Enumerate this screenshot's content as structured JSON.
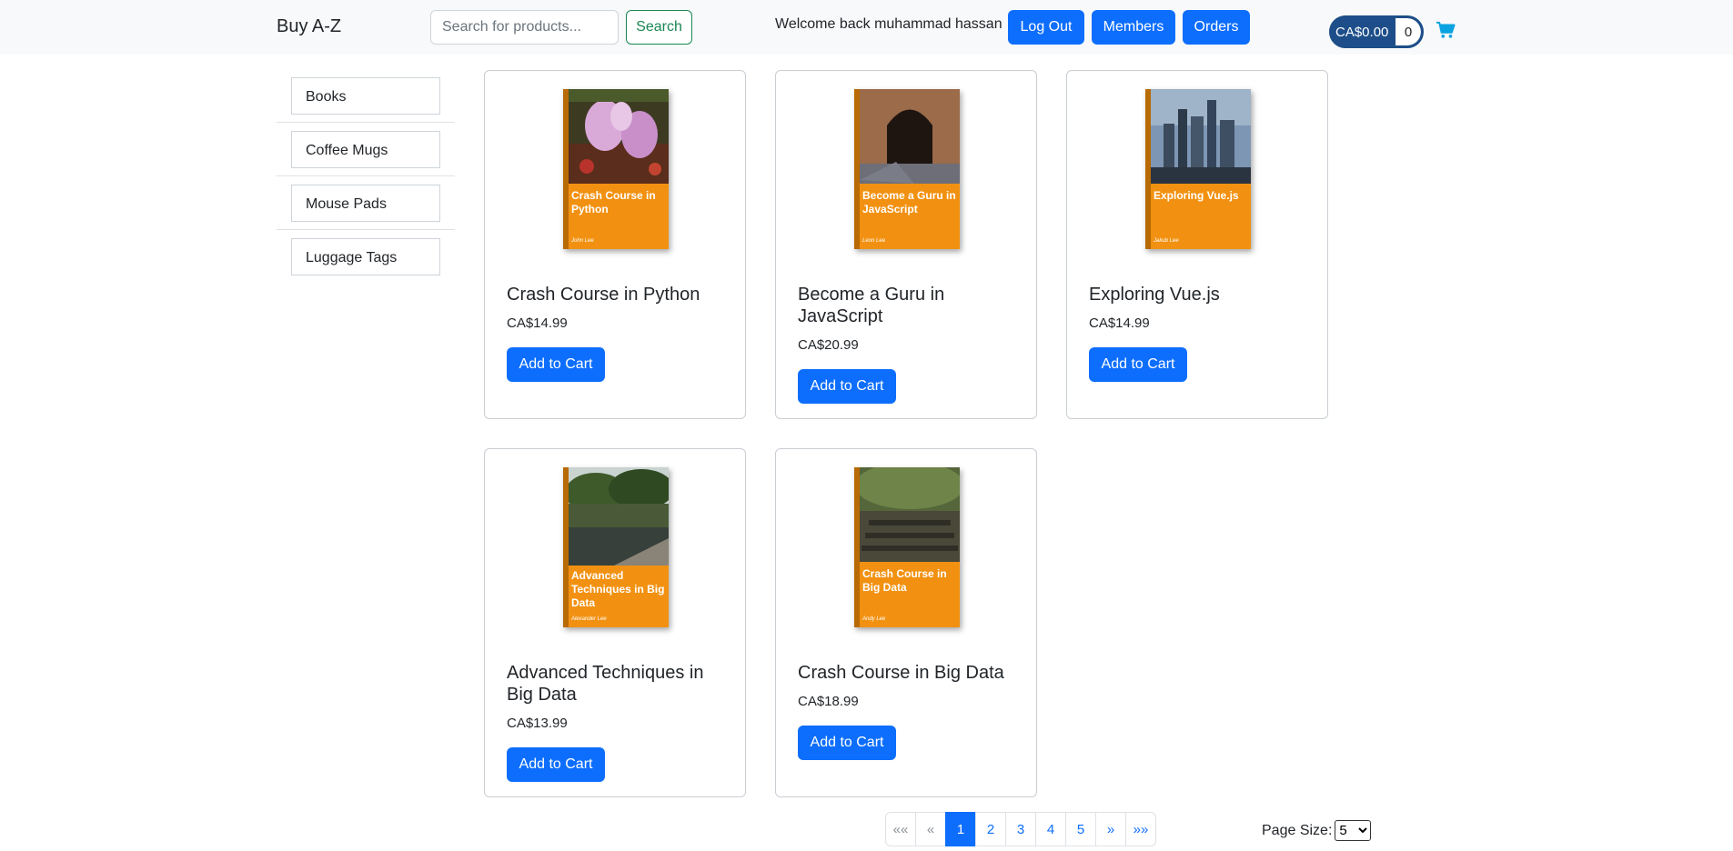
{
  "header": {
    "brand": "Buy A-Z",
    "search_placeholder": "Search for products...",
    "search_label": "Search",
    "welcome": "Welcome back muhammad hassan",
    "logout_label": "Log Out",
    "members_label": "Members",
    "orders_label": "Orders",
    "cart_total": "CA$0.00",
    "cart_count": "0",
    "cart_icon": "shopping-cart-icon"
  },
  "sidebar": {
    "categories": [
      {
        "label": "Books"
      },
      {
        "label": "Coffee Mugs"
      },
      {
        "label": "Mouse Pads"
      },
      {
        "label": "Luggage Tags"
      }
    ]
  },
  "products": [
    {
      "title": "Crash Course in Python",
      "price": "CA$14.99",
      "button": "Add to Cart",
      "cover_title": "Crash Course in Python",
      "cover_author": "John Lee"
    },
    {
      "title": "Become a Guru in JavaScript",
      "price": "CA$20.99",
      "button": "Add to Cart",
      "cover_title": "Become a Guru in JavaScript",
      "cover_author": "Leon Lee"
    },
    {
      "title": "Exploring Vue.js",
      "price": "CA$14.99",
      "button": "Add to Cart",
      "cover_title": "Exploring Vue.js",
      "cover_author": "Jakub Lee"
    },
    {
      "title": "Advanced Techniques in Big Data",
      "price": "CA$13.99",
      "button": "Add to Cart",
      "cover_title": "Advanced Techniques in Big Data",
      "cover_author": "Alexander Lee"
    },
    {
      "title": "Crash Course in Big Data",
      "price": "CA$18.99",
      "button": "Add to Cart",
      "cover_title": "Crash Course in Big Data",
      "cover_author": "Andy Lee"
    }
  ],
  "pagination": {
    "first": "««",
    "prev": "«",
    "pages": [
      "1",
      "2",
      "3",
      "4",
      "5"
    ],
    "current": "1",
    "next": "»",
    "last": "»»"
  },
  "page_size": {
    "label": "Page Size:",
    "selected": "5"
  },
  "colors": {
    "primary": "#0d6efd",
    "success": "#198754",
    "cover_orange": "#f29111",
    "cart_pill": "#1d4e89",
    "cart_icon": "#0aa2e0"
  }
}
